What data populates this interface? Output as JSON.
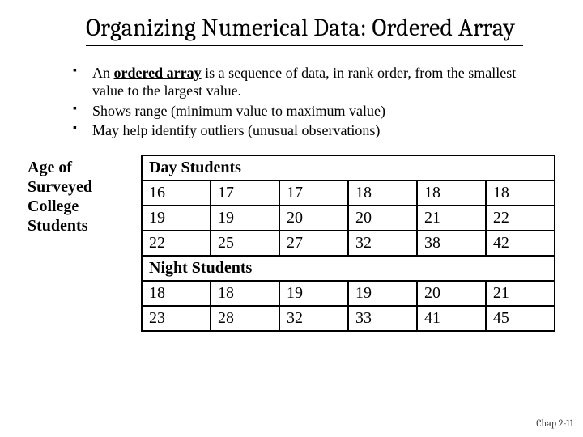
{
  "title": "Organizing Numerical Data: Ordered Array",
  "bullets": [
    {
      "prefix": "An ",
      "term": "ordered array",
      "rest": " is a sequence of data, in rank order, from the smallest value to the largest value."
    },
    {
      "prefix": "Shows range (minimum value to maximum value)",
      "term": "",
      "rest": ""
    },
    {
      "prefix": "May help identify outliers (unusual observations)",
      "term": "",
      "rest": ""
    }
  ],
  "left_label": "Age of Surveyed College Students",
  "sections": [
    {
      "header": "Day Students",
      "rows": [
        [
          "16",
          "17",
          "17",
          "18",
          "18",
          "18"
        ],
        [
          "19",
          "19",
          "20",
          "20",
          "21",
          "22"
        ],
        [
          "22",
          "25",
          "27",
          "32",
          "38",
          "42"
        ]
      ]
    },
    {
      "header": "Night Students",
      "rows": [
        [
          "18",
          "18",
          "19",
          "19",
          "20",
          "21"
        ],
        [
          "23",
          "28",
          "32",
          "33",
          "41",
          "45"
        ]
      ]
    }
  ],
  "footer": "Chap 2-11",
  "chart_data": {
    "type": "table",
    "title": "Age of Surveyed College Students",
    "groups": [
      {
        "name": "Day Students",
        "values": [
          16,
          17,
          17,
          18,
          18,
          18,
          19,
          19,
          20,
          20,
          21,
          22,
          22,
          25,
          27,
          32,
          38,
          42
        ]
      },
      {
        "name": "Night Students",
        "values": [
          18,
          18,
          19,
          19,
          20,
          21,
          23,
          28,
          32,
          33,
          41,
          45
        ]
      }
    ]
  }
}
